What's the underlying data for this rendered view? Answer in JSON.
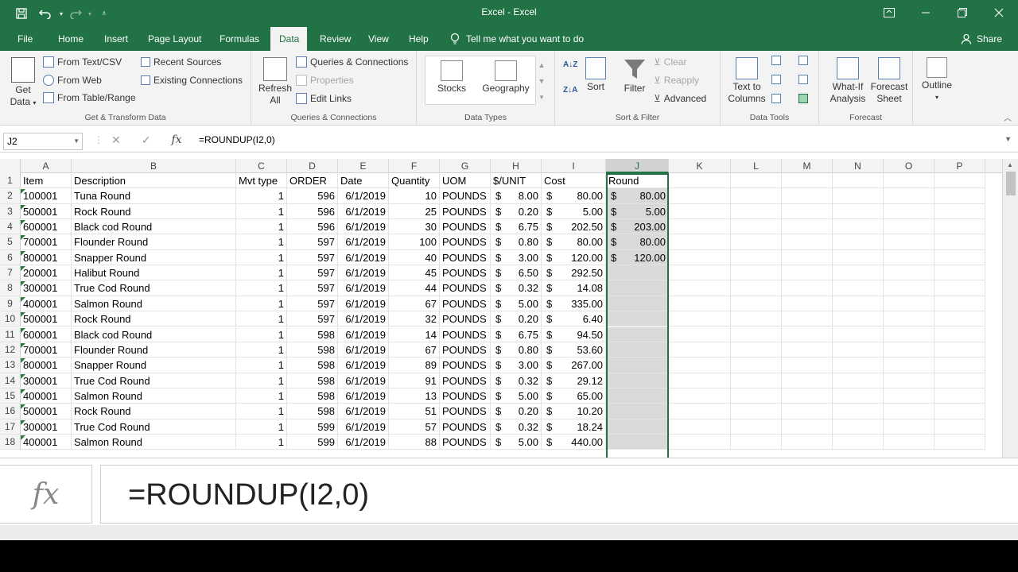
{
  "titlebar": {
    "title": "Excel  -  Excel",
    "save_icon": "save-icon",
    "undo_icon": "undo-icon",
    "redo_icon": "redo-icon",
    "customize_icon": "customize-qat-icon"
  },
  "tabs": [
    "File",
    "Home",
    "Insert",
    "Page Layout",
    "Formulas",
    "Data",
    "Review",
    "View",
    "Help"
  ],
  "active_tab": "Data",
  "tell_me": "Tell me what you want to do",
  "share": "Share",
  "ribbon": {
    "get_transform": {
      "get_data": "Get Data",
      "get_data_arrow": "▾",
      "from_text_csv": "From Text/CSV",
      "from_web": "From Web",
      "from_table": "From Table/Range",
      "recent_sources": "Recent Sources",
      "existing_connections": "Existing Connections",
      "label": "Get & Transform Data"
    },
    "queries": {
      "refresh_all": "Refresh All",
      "queries_connections": "Queries & Connections",
      "properties": "Properties",
      "edit_links": "Edit Links",
      "label": "Queries & Connections"
    },
    "data_types": {
      "stocks": "Stocks",
      "geography": "Geography",
      "label": "Data Types"
    },
    "sort_filter": {
      "sort": "Sort",
      "filter": "Filter",
      "clear": "Clear",
      "reapply": "Reapply",
      "advanced": "Advanced",
      "label": "Sort & Filter"
    },
    "data_tools": {
      "text_to_columns": "Text to Columns",
      "label": "Data Tools"
    },
    "forecast": {
      "what_if": "What-If Analysis",
      "forecast_sheet": "Forecast Sheet",
      "label": "Forecast"
    },
    "outline": {
      "outline": "Outline"
    }
  },
  "formula_bar": {
    "name_box": "J2",
    "cancel": "✕",
    "enter": "✓",
    "fx": "fx",
    "formula": "=ROUNDUP(I2,0)"
  },
  "columns": [
    "A",
    "B",
    "C",
    "D",
    "E",
    "F",
    "G",
    "H",
    "I",
    "J",
    "K",
    "L",
    "M",
    "N",
    "O",
    "P"
  ],
  "headers": {
    "item": "Item",
    "description": "Description",
    "mvt": "Mvt type",
    "order": "ORDER",
    "date": "Date",
    "qty": "Quantity",
    "uom": "UOM",
    "unit": "$/UNIT",
    "cost": "Cost",
    "round": "Round"
  },
  "currency_symbol": "$",
  "rows": [
    {
      "n": "2",
      "item": "100001",
      "desc": "Tuna Round",
      "mvt": "1",
      "order": "596",
      "date": "6/1/2019",
      "qty": "10",
      "uom": "POUNDS",
      "unit": "8.00",
      "cost": "80.00",
      "round": "80.00"
    },
    {
      "n": "3",
      "item": "500001",
      "desc": "Rock Round",
      "mvt": "1",
      "order": "596",
      "date": "6/1/2019",
      "qty": "25",
      "uom": "POUNDS",
      "unit": "0.20",
      "cost": "5.00",
      "round": "5.00"
    },
    {
      "n": "4",
      "item": "600001",
      "desc": "Black cod Round",
      "mvt": "1",
      "order": "596",
      "date": "6/1/2019",
      "qty": "30",
      "uom": "POUNDS",
      "unit": "6.75",
      "cost": "202.50",
      "round": "203.00"
    },
    {
      "n": "5",
      "item": "700001",
      "desc": "Flounder Round",
      "mvt": "1",
      "order": "597",
      "date": "6/1/2019",
      "qty": "100",
      "uom": "POUNDS",
      "unit": "0.80",
      "cost": "80.00",
      "round": "80.00"
    },
    {
      "n": "6",
      "item": "800001",
      "desc": "Snapper Round",
      "mvt": "1",
      "order": "597",
      "date": "6/1/2019",
      "qty": "40",
      "uom": "POUNDS",
      "unit": "3.00",
      "cost": "120.00",
      "round": "120.00"
    },
    {
      "n": "7",
      "item": "200001",
      "desc": "Halibut Round",
      "mvt": "1",
      "order": "597",
      "date": "6/1/2019",
      "qty": "45",
      "uom": "POUNDS",
      "unit": "6.50",
      "cost": "292.50",
      "round": ""
    },
    {
      "n": "8",
      "item": "300001",
      "desc": "True Cod Round",
      "mvt": "1",
      "order": "597",
      "date": "6/1/2019",
      "qty": "44",
      "uom": "POUNDS",
      "unit": "0.32",
      "cost": "14.08",
      "round": ""
    },
    {
      "n": "9",
      "item": "400001",
      "desc": "Salmon Round",
      "mvt": "1",
      "order": "597",
      "date": "6/1/2019",
      "qty": "67",
      "uom": "POUNDS",
      "unit": "5.00",
      "cost": "335.00",
      "round": ""
    },
    {
      "n": "10",
      "item": "500001",
      "desc": "Rock Round",
      "mvt": "1",
      "order": "597",
      "date": "6/1/2019",
      "qty": "32",
      "uom": "POUNDS",
      "unit": "0.20",
      "cost": "6.40",
      "round": ""
    },
    {
      "n": "11",
      "item": "600001",
      "desc": "Black cod Round",
      "mvt": "1",
      "order": "598",
      "date": "6/1/2019",
      "qty": "14",
      "uom": "POUNDS",
      "unit": "6.75",
      "cost": "94.50",
      "round": ""
    },
    {
      "n": "12",
      "item": "700001",
      "desc": "Flounder Round",
      "mvt": "1",
      "order": "598",
      "date": "6/1/2019",
      "qty": "67",
      "uom": "POUNDS",
      "unit": "0.80",
      "cost": "53.60",
      "round": ""
    },
    {
      "n": "13",
      "item": "800001",
      "desc": "Snapper Round",
      "mvt": "1",
      "order": "598",
      "date": "6/1/2019",
      "qty": "89",
      "uom": "POUNDS",
      "unit": "3.00",
      "cost": "267.00",
      "round": ""
    },
    {
      "n": "14",
      "item": "300001",
      "desc": "True Cod Round",
      "mvt": "1",
      "order": "598",
      "date": "6/1/2019",
      "qty": "91",
      "uom": "POUNDS",
      "unit": "0.32",
      "cost": "29.12",
      "round": ""
    },
    {
      "n": "15",
      "item": "400001",
      "desc": "Salmon Round",
      "mvt": "1",
      "order": "598",
      "date": "6/1/2019",
      "qty": "13",
      "uom": "POUNDS",
      "unit": "5.00",
      "cost": "65.00",
      "round": ""
    },
    {
      "n": "16",
      "item": "500001",
      "desc": "Rock Round",
      "mvt": "1",
      "order": "598",
      "date": "6/1/2019",
      "qty": "51",
      "uom": "POUNDS",
      "unit": "0.20",
      "cost": "10.20",
      "round": ""
    },
    {
      "n": "17",
      "item": "300001",
      "desc": "True Cod Round",
      "mvt": "1",
      "order": "599",
      "date": "6/1/2019",
      "qty": "57",
      "uom": "POUNDS",
      "unit": "0.32",
      "cost": "18.24",
      "round": ""
    },
    {
      "n": "18",
      "item": "400001",
      "desc": "Salmon Round",
      "mvt": "1",
      "order": "599",
      "date": "6/1/2019",
      "qty": "88",
      "uom": "POUNDS",
      "unit": "5.00",
      "cost": "440.00",
      "round": ""
    }
  ],
  "zoom_formula": {
    "fx": "fx",
    "formula": "=ROUNDUP(I2,0)"
  },
  "colors": {
    "excel_green": "#217346",
    "selection_gray": "#d9d9d9"
  }
}
